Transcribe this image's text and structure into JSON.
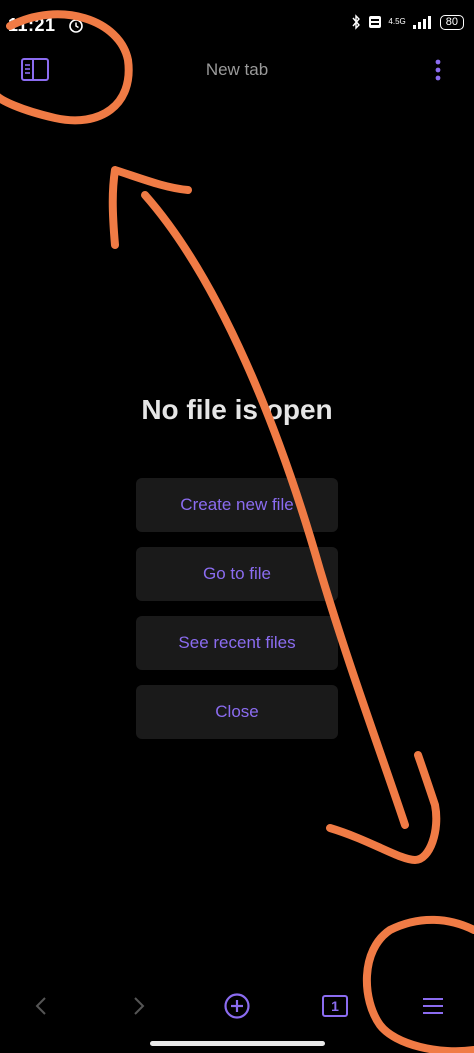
{
  "status_bar": {
    "time": "11:21",
    "network": "4.5G",
    "battery": "80"
  },
  "header": {
    "title": "New tab"
  },
  "empty_state": {
    "title": "No file is open",
    "actions": [
      "Create new file",
      "Go to file",
      "See recent files",
      "Close"
    ]
  },
  "bottom_nav": {
    "tab_count": "1"
  },
  "colors": {
    "accent": "#8b6cf0",
    "annotation": "#f07b45",
    "background": "#000000"
  }
}
